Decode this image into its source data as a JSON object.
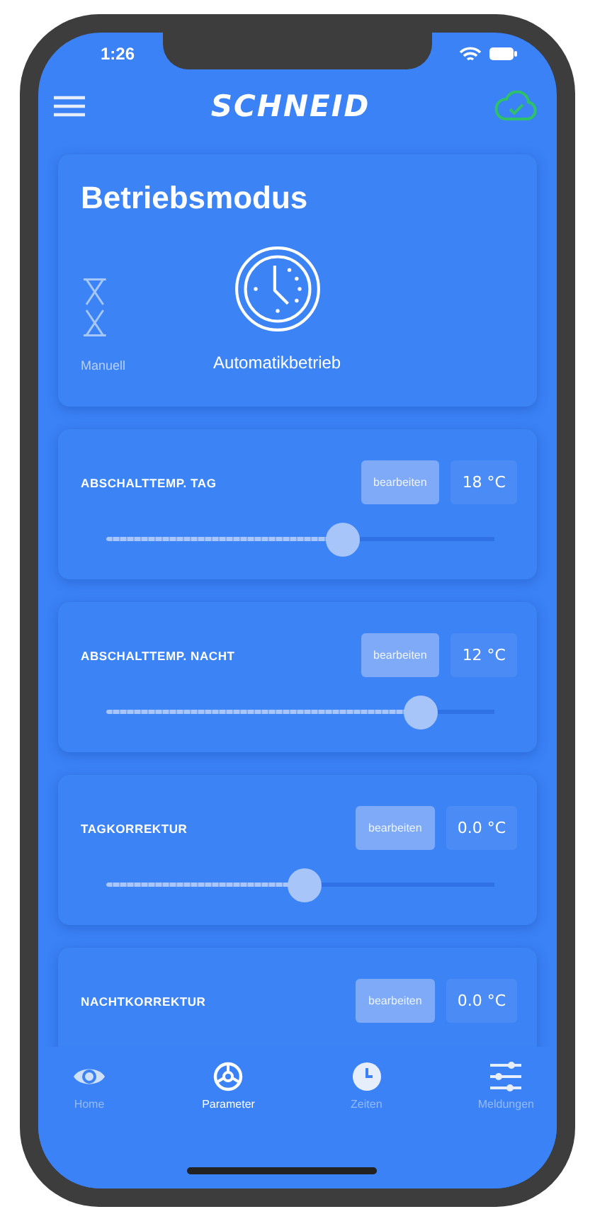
{
  "status_bar": {
    "time": "1:26"
  },
  "header": {
    "logo": "SCHNEID",
    "cloud_synced": true
  },
  "mode_card": {
    "title": "Betriebsmodus",
    "modes": [
      {
        "label": "Manuell",
        "selected": false
      },
      {
        "label": "Automatikbetrieb",
        "selected": true
      }
    ]
  },
  "parameters": [
    {
      "label": "ABSCHALTTEMP. TAG",
      "button": "bearbeiten",
      "value": "18 °C",
      "level": 0.61
    },
    {
      "label": "ABSCHALTTEMP. NACHT",
      "button": "bearbeiten",
      "value": "12 °C",
      "level": 0.81
    },
    {
      "label": "TAGKORREKTUR",
      "button": "bearbeiten",
      "value": "0.0 °C",
      "level": 0.51
    },
    {
      "label": "NACHTKORREKTUR",
      "button": "bearbeiten",
      "value": "0.0 °C"
    }
  ],
  "tab_bar": [
    {
      "label": "Home",
      "selected": false
    },
    {
      "label": "Parameter",
      "selected": true
    },
    {
      "label": "Zeiten",
      "selected": false
    },
    {
      "label": "Meldungen",
      "selected": false
    }
  ]
}
